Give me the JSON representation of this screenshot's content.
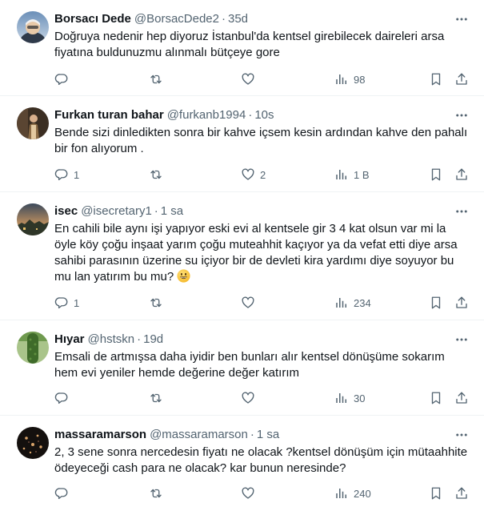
{
  "tweets": [
    {
      "name": "Borsacı Dede",
      "handle": "@BorsacDede2",
      "time": "35d",
      "text": "Doğruya nedenir hep diyoruz İstanbul'da kentsel girebilecek daireleri arsa fiyatına buldunuzmu alınmalı bütçeye gore",
      "replies": "",
      "likes": "",
      "views": "98"
    },
    {
      "name": "Furkan turan bahar",
      "handle": "@furkanb1994",
      "time": "10s",
      "text": "Bende sizi dinledikten sonra bir kahve içsem kesin ardından kahve den pahalı bir fon alıyorum .",
      "replies": "1",
      "likes": "2",
      "views": "1 B"
    },
    {
      "name": "isec",
      "handle": "@isecretary1",
      "time": "1 sa",
      "text": "En cahili bile aynı işi yapıyor eski evi al kentsele gir 3 4 kat olsun var mi la öyle köy çoğu inşaat yarım çoğu muteahhit kaçıyor ya da vefat etti diye arsa sahibi parasının üzerine su içiyor bir de devleti kira yardımı diye soyuyor bu mu lan yatırım bu mu?",
      "replies": "1",
      "likes": "",
      "views": "234"
    },
    {
      "name": "Hıyar",
      "handle": "@hstskn",
      "time": "19d",
      "text": "Emsali de artmışsa daha iyidir ben bunları alır kentsel dönüşüme sokarım hem evi yeniler hemde değerine değer katırım",
      "replies": "",
      "likes": "",
      "views": "30"
    },
    {
      "name": "massaramarson",
      "handle": "@massaramarson",
      "time": "1 sa",
      "text": "2, 3 sene sonra nercedesin fiyatı ne olacak ?kentsel dönüşüm için mütaahhite ödeyeceği cash para ne olacak? kar bunun neresinde?",
      "replies": "",
      "likes": "",
      "views": "240"
    }
  ],
  "colors": {
    "text": "#0f1419",
    "secondary": "#536471",
    "divider": "#eff3f4"
  },
  "icons": [
    "reply-icon",
    "retweet-icon",
    "like-icon",
    "views-icon",
    "bookmark-icon",
    "share-icon",
    "more-icon",
    "smiley-emoji"
  ]
}
